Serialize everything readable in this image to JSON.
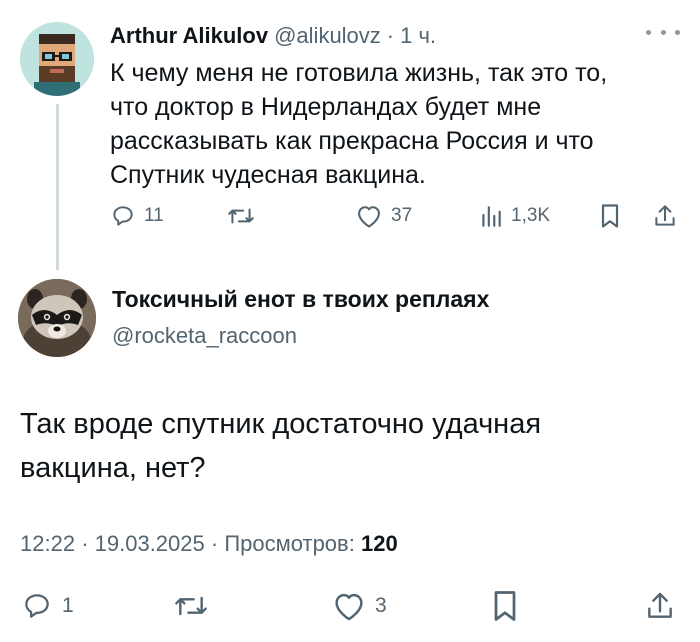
{
  "original_tweet": {
    "author_name": "Arthur Alikulov",
    "handle": "@alikulovz",
    "separator": "·",
    "time_ago": "1 ч.",
    "text": "К чему меня не готовила жизнь, так это то,\nчто доктор в Нидерландах будет мне\nрассказывать как прекрасна Россия и что\nСпутник чудесная вакцина.",
    "replies": "11",
    "likes": "37",
    "views": "1,3K"
  },
  "reply_tweet": {
    "author_name": "Токсичный енот в твоих реплаях",
    "handle": "@rocketa_raccoon",
    "text": "Так вроде спутник достаточно удачная\nвакцина, нет?",
    "time": "12:22",
    "separator": "·",
    "date": "19.03.2025",
    "views_label": "Просмотров:",
    "views_count": "120",
    "replies": "1",
    "likes": "3"
  },
  "colors": {
    "text_primary": "#0f1419",
    "text_secondary": "#536471",
    "thread_line": "#cfd9de"
  },
  "icons": [
    "reply-icon",
    "retweet-icon",
    "like-icon",
    "views-icon",
    "bookmark-icon",
    "share-icon",
    "more-icon"
  ]
}
